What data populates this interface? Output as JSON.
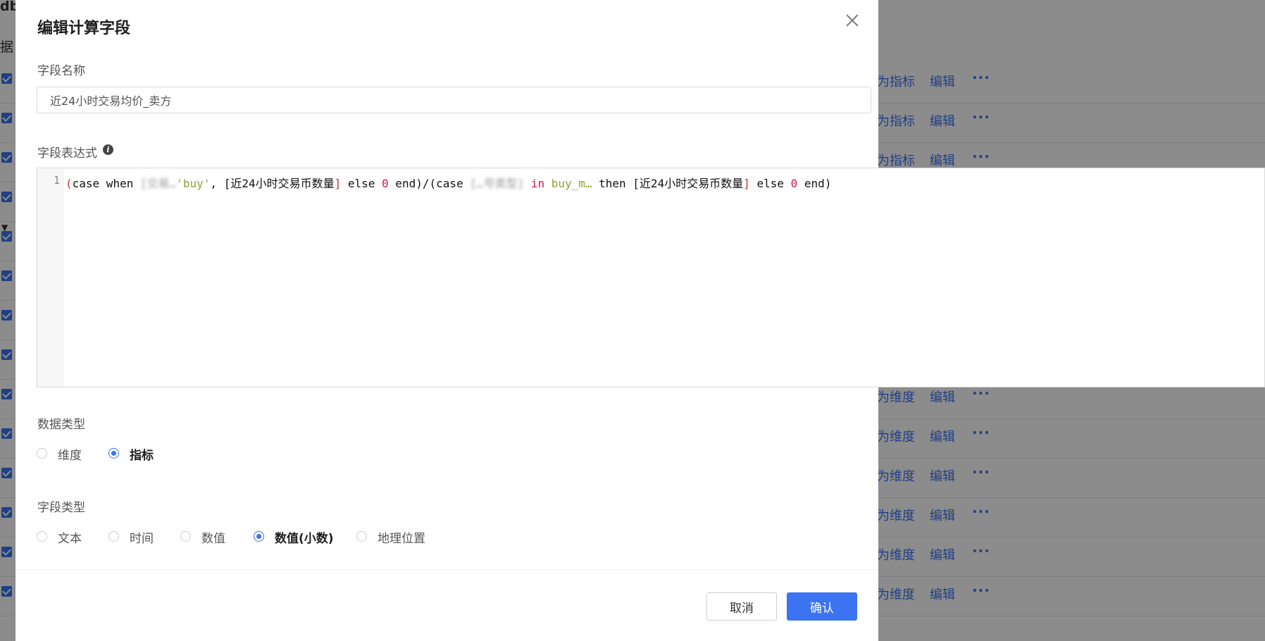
{
  "background": {
    "title": "db",
    "subtitle": "据",
    "rows": [
      {
        "action": "为指标",
        "edit": "编辑",
        "more": "···"
      },
      {
        "action": "为指标",
        "edit": "编辑",
        "more": "···"
      },
      {
        "action": "为指标",
        "edit": "编辑",
        "more": "···"
      },
      {
        "action": "",
        "edit": "",
        "more": ""
      },
      {
        "action": "",
        "edit": "",
        "more": ""
      },
      {
        "action": "",
        "edit": "",
        "more": ""
      },
      {
        "action": "",
        "edit": "",
        "more": ""
      },
      {
        "action": "",
        "edit": "",
        "more": ""
      },
      {
        "action": "为维度",
        "edit": "编辑",
        "more": "···"
      },
      {
        "action": "为维度",
        "edit": "编辑",
        "more": "···"
      },
      {
        "action": "为维度",
        "edit": "编辑",
        "more": "···"
      },
      {
        "action": "为维度",
        "edit": "编辑",
        "more": "···"
      },
      {
        "action": "为维度",
        "edit": "编辑",
        "more": "···"
      },
      {
        "action": "为维度",
        "edit": "编辑",
        "more": "···"
      }
    ]
  },
  "modal": {
    "title": "编辑计算字段",
    "field_name_label": "字段名称",
    "field_name_value": "近24小时交易均价_卖方",
    "expression_label": "字段表达式",
    "info_icon": "i",
    "editor": {
      "line_number": "1",
      "tokens": {
        "t1": "(",
        "t2": "case when ",
        "t3": "[交易…",
        "t4": "'buy'",
        "t5": ", ",
        "t6": "[近24小时交易币数量",
        "t7": "]",
        "t8": " else ",
        "t9": "0",
        "t10": " end)/(case ",
        "t11": "[…号类型]",
        "t12": " in ",
        "t13": "buy_m…",
        "t14": " then ",
        "t15": "[近24小时交易币数量",
        "t16": "]",
        "t17": " else ",
        "t18": "0",
        "t19": " end)"
      }
    },
    "data_type_label": "数据类型",
    "data_type_options": [
      {
        "label": "维度",
        "checked": false
      },
      {
        "label": "指标",
        "checked": true
      }
    ],
    "field_type_label": "字段类型",
    "field_type_options": [
      {
        "label": "文本",
        "checked": false
      },
      {
        "label": "时间",
        "checked": false
      },
      {
        "label": "数值",
        "checked": false
      },
      {
        "label": "数值(小数)",
        "checked": true
      },
      {
        "label": "地理位置",
        "checked": false
      }
    ],
    "cancel_label": "取消",
    "confirm_label": "确认"
  },
  "colors": {
    "primary": "#3b73f0",
    "overlay": "rgba(0,0,0,0.45)"
  }
}
